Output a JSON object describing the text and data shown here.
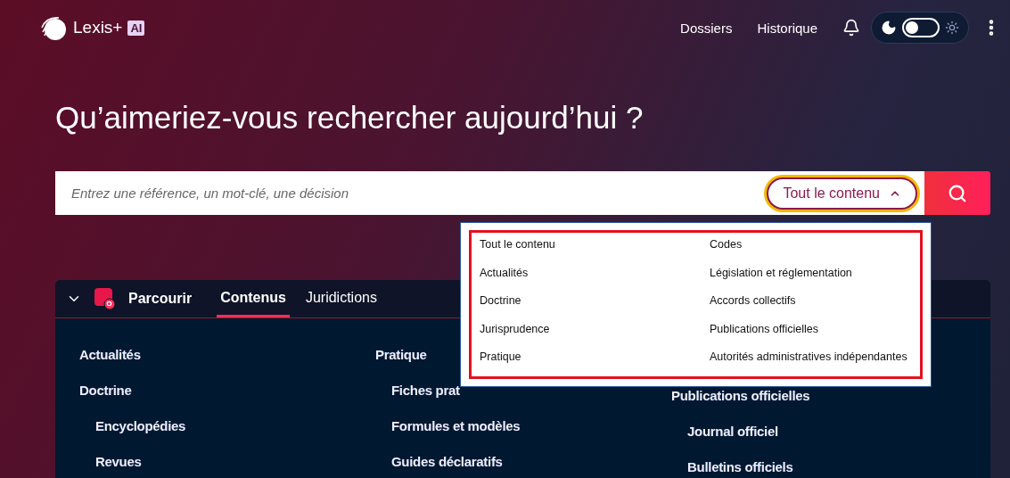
{
  "header": {
    "logo": "Lexis+",
    "logo_badge": "AI",
    "nav": [
      "Dossiers",
      "Historique"
    ],
    "theme_toggle": {
      "dark": true
    }
  },
  "heading": "Qu’aimeriez-vous rechercher aujourd’hui ?",
  "search": {
    "placeholder": "Entrez une référence, un mot-clé, une décision",
    "scope": "Tout le contenu",
    "expanded": true
  },
  "scope_menu": {
    "columns": [
      [
        "Tout le contenu",
        "Actualités",
        "Doctrine",
        "Jurisprudence",
        "Pratique"
      ],
      [
        "Codes",
        "Législation et réglementation",
        "Accords collectifs",
        "Publications officielles",
        "Autorités administratives indépendantes"
      ]
    ]
  },
  "browse": {
    "title": "Parcourir",
    "expanded": true,
    "tabs": [
      {
        "label": "Contenus",
        "selected": true
      },
      {
        "label": "Juridictions",
        "selected": false
      }
    ],
    "columns": [
      [
        {
          "label": "Actualités",
          "kind": "heading"
        },
        {
          "label": "Doctrine",
          "kind": "heading"
        },
        {
          "label": "Encyclopédies",
          "kind": "item"
        },
        {
          "label": "Revues",
          "kind": "item"
        }
      ],
      [
        {
          "label": "Pratique",
          "kind": "heading"
        },
        {
          "label": "Fiches prat",
          "kind": "item"
        },
        {
          "label": "Formules et modèles",
          "kind": "item"
        },
        {
          "label": "Guides déclaratifs",
          "kind": "item"
        }
      ],
      [
        {
          "label": "Publications officielles",
          "kind": "heading"
        },
        {
          "label": "Journal officiel",
          "kind": "item"
        },
        {
          "label": "Bulletins officiels",
          "kind": "item"
        }
      ]
    ]
  }
}
